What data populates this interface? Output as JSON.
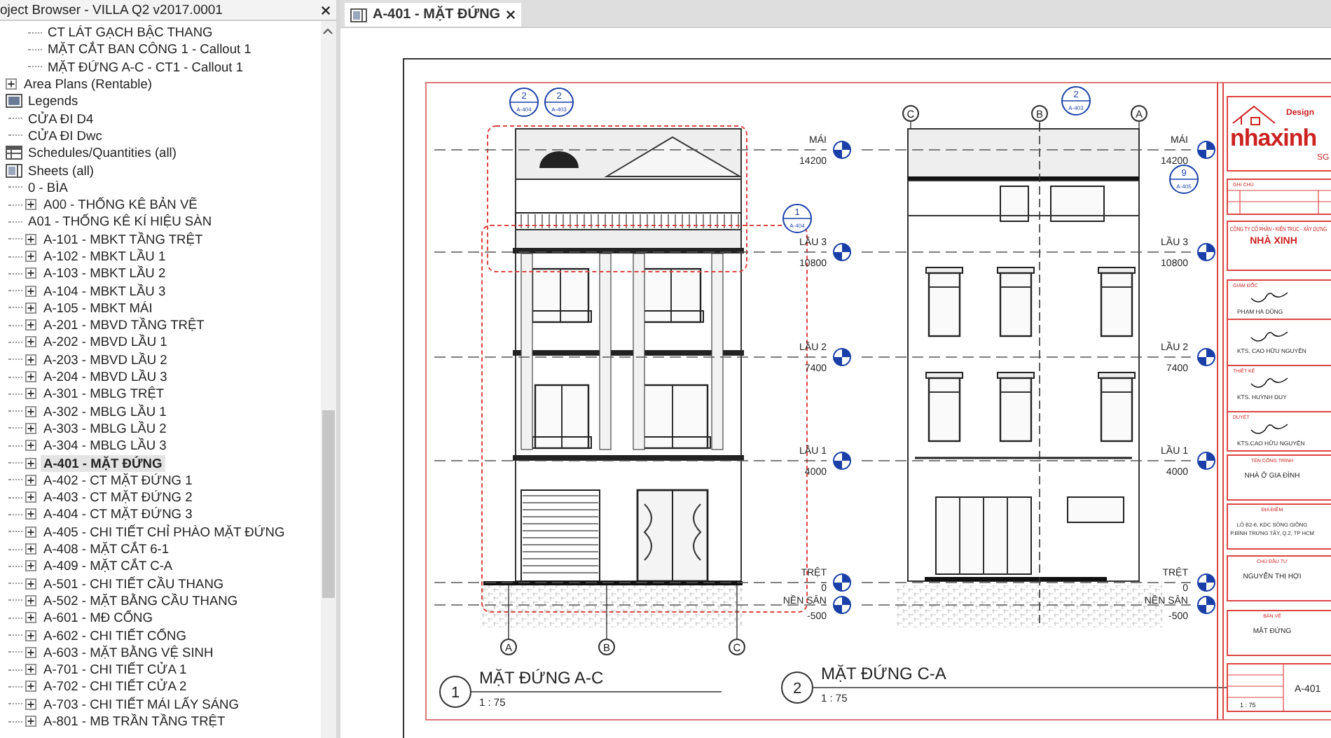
{
  "browser": {
    "title": "oject Browser - VILLA Q2 v2017.0001",
    "continued_items": [
      "CT LÁT GẠCH BẬC THANG",
      "MẶT CẮT BAN CÔNG 1 - Callout 1",
      "MẶT ĐỨNG A-C - CT1 - Callout 1"
    ],
    "tree": [
      {
        "label": "Area Plans (Rentable)",
        "kind": "folder",
        "expandable": true,
        "selected": false
      },
      {
        "label": "Legends",
        "kind": "legend",
        "expandable": false,
        "selected": false,
        "children": [
          {
            "label": "CỬA ĐI D4",
            "expandable": false,
            "selected": false
          },
          {
            "label": "CỬA ĐI Dwc",
            "expandable": false,
            "selected": false
          }
        ]
      },
      {
        "label": "Schedules/Quantities (all)",
        "kind": "schedule",
        "expandable": false,
        "selected": false
      },
      {
        "label": "Sheets (all)",
        "kind": "sheet",
        "expandable": false,
        "selected": false,
        "children": [
          {
            "label": "0 - BÌA",
            "expandable": false,
            "selected": false
          },
          {
            "label": "A00 - THỐNG KÊ BẢN VẼ",
            "expandable": true,
            "selected": false
          },
          {
            "label": "A01 - THỐNG KÊ KÍ HIỆU SÀN",
            "expandable": false,
            "selected": false
          },
          {
            "label": "A-101 - MBKT TẦNG TRỆT",
            "expandable": true,
            "selected": false
          },
          {
            "label": "A-102 - MBKT LẦU 1",
            "expandable": true,
            "selected": false
          },
          {
            "label": "A-103 - MBKT LẦU 2",
            "expandable": true,
            "selected": false
          },
          {
            "label": "A-104 - MBKT LẦU 3",
            "expandable": true,
            "selected": false
          },
          {
            "label": "A-105 - MBKT MÁI",
            "expandable": true,
            "selected": false
          },
          {
            "label": "A-201 - MBVD TẦNG TRỆT",
            "expandable": true,
            "selected": false
          },
          {
            "label": "A-202 - MBVD LẦU 1",
            "expandable": true,
            "selected": false
          },
          {
            "label": "A-203 - MBVD LẦU 2",
            "expandable": true,
            "selected": false
          },
          {
            "label": "A-204 - MBVD LẦU 3",
            "expandable": true,
            "selected": false
          },
          {
            "label": "A-301 - MBLG TRỆT",
            "expandable": true,
            "selected": false
          },
          {
            "label": "A-302 - MBLG LẦU 1",
            "expandable": true,
            "selected": false
          },
          {
            "label": "A-303 - MBLG LẦU 2",
            "expandable": true,
            "selected": false
          },
          {
            "label": "A-304 - MBLG LẦU 3",
            "expandable": true,
            "selected": false
          },
          {
            "label": "A-401 - MẶT ĐỨNG",
            "expandable": true,
            "selected": true
          },
          {
            "label": "A-402 - CT MẶT ĐỨNG 1",
            "expandable": true,
            "selected": false
          },
          {
            "label": "A-403 - CT MẶT ĐỨNG 2",
            "expandable": true,
            "selected": false
          },
          {
            "label": "A-404 - CT MẶT ĐỨNG 3",
            "expandable": true,
            "selected": false
          },
          {
            "label": "A-405 - CHI TIẾT CHỈ PHÀO MẶT ĐỨNG",
            "expandable": true,
            "selected": false
          },
          {
            "label": "A-408 - MẶT CẮT 6-1",
            "expandable": true,
            "selected": false
          },
          {
            "label": "A-409 - MẶT CẮT C-A",
            "expandable": true,
            "selected": false
          },
          {
            "label": "A-501 - CHI TIẾT CẦU THANG",
            "expandable": true,
            "selected": false
          },
          {
            "label": "A-502 - MẶT BẰNG CẦU THANG",
            "expandable": true,
            "selected": false
          },
          {
            "label": "A-601 - MĐ CỔNG",
            "expandable": true,
            "selected": false
          },
          {
            "label": "A-602 - CHI TIẾT CỔNG",
            "expandable": true,
            "selected": false
          },
          {
            "label": "A-603 - MẶT BẰNG VỆ SINH",
            "expandable": true,
            "selected": false
          },
          {
            "label": "A-701 - CHI TIẾT CỬA 1",
            "expandable": true,
            "selected": false
          },
          {
            "label": "A-702 - CHI TIẾT CỬA 2",
            "expandable": true,
            "selected": false
          },
          {
            "label": "A-703 - CHI TIẾT MÁI LẤY SÁNG",
            "expandable": true,
            "selected": false
          },
          {
            "label": "A-801 - MB TRẦN TẦNG TRỆT",
            "expandable": true,
            "selected": false
          }
        ]
      }
    ]
  },
  "tab": {
    "label": "A-401 - MẶT ĐỨNG",
    "selected": true
  },
  "sheet": {
    "views": [
      {
        "number": "1",
        "title": "MẶT ĐỨNG A-C",
        "scale": "1 : 75",
        "grids": [
          "A",
          "B",
          "C"
        ],
        "levels": [
          {
            "name": "MÁI",
            "elevation": "14200"
          },
          {
            "name": "LẦU 3",
            "elevation": "10800"
          },
          {
            "name": "LẦU 2",
            "elevation": "7400"
          },
          {
            "name": "LẦU 1",
            "elevation": "4000"
          },
          {
            "name": "TRỆT",
            "elevation": "0"
          },
          {
            "name": "NỀN SÂN",
            "elevation": "-500"
          }
        ],
        "callouts": [
          {
            "number": "2",
            "sheet": "A-404"
          },
          {
            "number": "2",
            "sheet": "A-403"
          },
          {
            "number": "1",
            "sheet": "A-404"
          }
        ]
      },
      {
        "number": "2",
        "title": "MẶT ĐỨNG C-A",
        "scale": "1 : 75",
        "grids": [
          "C",
          "B",
          "A"
        ],
        "levels": [
          {
            "name": "MÁI",
            "elevation": "14200"
          },
          {
            "name": "LẦU 3",
            "elevation": "10800"
          },
          {
            "name": "LẦU 2",
            "elevation": "7400"
          },
          {
            "name": "LẦU 1",
            "elevation": "4000"
          },
          {
            "name": "TRỆT",
            "elevation": "0"
          },
          {
            "name": "NỀN SÂN",
            "elevation": "-500"
          }
        ],
        "callouts": [
          {
            "number": "2",
            "sheet": "A-403"
          },
          {
            "number": "9",
            "sheet": "A-405"
          }
        ]
      }
    ],
    "title_block": {
      "logo": "nhaxinh",
      "logo_top": "Design",
      "logo_suffix": "SG",
      "notes_heading": "GHI CHÚ",
      "company_line": "CÔNG TY CỔ PHẦN - KIẾN TRÚC - XÂY DỰNG",
      "company": "NHÀ XINH",
      "signers": [
        {
          "role": "GIÁM ĐỐC",
          "name": "PHẠM HÀ DŨNG"
        },
        {
          "name": "KTS. CAO HỮU NGUYÊN"
        },
        {
          "role": "THIẾT KẾ",
          "name": "KTS. HUỲNH DUY"
        },
        {
          "role": "DUYỆT",
          "name": "KTS.CAO HỮU NGUYÊN"
        }
      ],
      "fields": [
        {
          "heading": "TÊN CÔNG TRÌNH",
          "lines": [
            "NHÀ Ở GIA ĐÌNH"
          ]
        },
        {
          "heading": "ĐỊA ĐIỂM",
          "lines": [
            "LÔ B2-6, KDC SÔNG GIỒNG",
            "P.BÌNH TRƯNG TÂY, Q.2, TP HCM"
          ]
        },
        {
          "heading": "CHỦ ĐẦU TƯ",
          "lines": [
            "NGUYỄN THỊ HỢI"
          ]
        },
        {
          "heading": "BẢN VẼ",
          "lines": [
            "MẶT ĐỨNG"
          ]
        }
      ],
      "scale": "1 : 75",
      "sheet_number": "A-401"
    }
  }
}
